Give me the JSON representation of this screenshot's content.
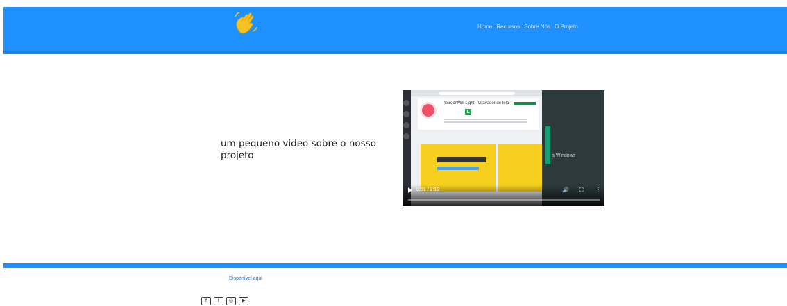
{
  "header": {
    "logo_icon": "waving-hand-icon",
    "nav": [
      "Home",
      "Recursos",
      "Sobre Nós",
      "O Projeto"
    ],
    "brand_color": "#1e90ff"
  },
  "main": {
    "intro_text": "um pequeno video sobre o nosso projeto",
    "video": {
      "time": "0:01 / 2:12",
      "progress_fraction": 0.008,
      "inner_title": "ScreenMin Light - Gravador de tela",
      "inner_letter": "L",
      "inner_side_text": "a Windows"
    }
  },
  "footer": {
    "link_label": "Disponível aqui",
    "social": [
      "facebook-icon",
      "twitter-icon",
      "instagram-icon",
      "youtube-icon"
    ]
  }
}
